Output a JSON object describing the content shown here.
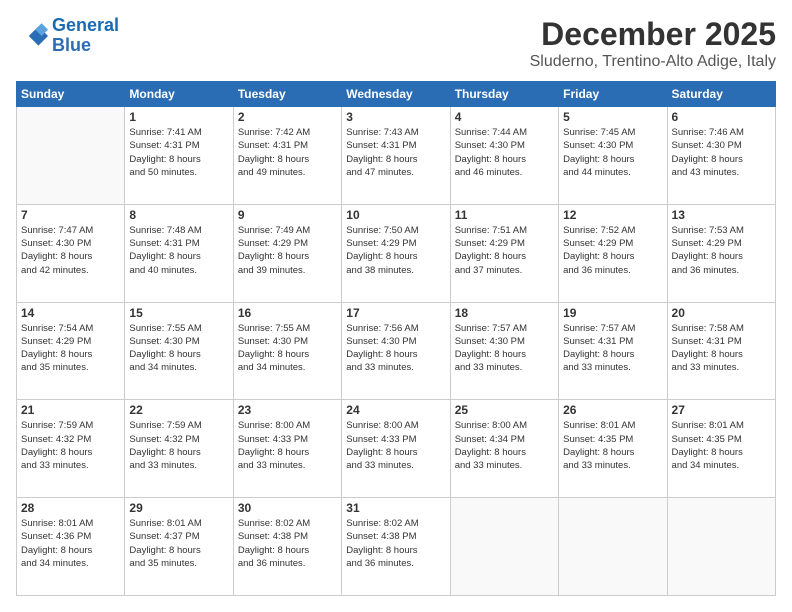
{
  "logo": {
    "line1": "General",
    "line2": "Blue"
  },
  "title": "December 2025",
  "subtitle": "Sluderno, Trentino-Alto Adige, Italy",
  "days_of_week": [
    "Sunday",
    "Monday",
    "Tuesday",
    "Wednesday",
    "Thursday",
    "Friday",
    "Saturday"
  ],
  "weeks": [
    [
      {
        "day": "",
        "info": ""
      },
      {
        "day": "1",
        "info": "Sunrise: 7:41 AM\nSunset: 4:31 PM\nDaylight: 8 hours\nand 50 minutes."
      },
      {
        "day": "2",
        "info": "Sunrise: 7:42 AM\nSunset: 4:31 PM\nDaylight: 8 hours\nand 49 minutes."
      },
      {
        "day": "3",
        "info": "Sunrise: 7:43 AM\nSunset: 4:31 PM\nDaylight: 8 hours\nand 47 minutes."
      },
      {
        "day": "4",
        "info": "Sunrise: 7:44 AM\nSunset: 4:30 PM\nDaylight: 8 hours\nand 46 minutes."
      },
      {
        "day": "5",
        "info": "Sunrise: 7:45 AM\nSunset: 4:30 PM\nDaylight: 8 hours\nand 44 minutes."
      },
      {
        "day": "6",
        "info": "Sunrise: 7:46 AM\nSunset: 4:30 PM\nDaylight: 8 hours\nand 43 minutes."
      }
    ],
    [
      {
        "day": "7",
        "info": "Sunrise: 7:47 AM\nSunset: 4:30 PM\nDaylight: 8 hours\nand 42 minutes."
      },
      {
        "day": "8",
        "info": "Sunrise: 7:48 AM\nSunset: 4:31 PM\nDaylight: 8 hours\nand 40 minutes."
      },
      {
        "day": "9",
        "info": "Sunrise: 7:49 AM\nSunset: 4:29 PM\nDaylight: 8 hours\nand 39 minutes."
      },
      {
        "day": "10",
        "info": "Sunrise: 7:50 AM\nSunset: 4:29 PM\nDaylight: 8 hours\nand 38 minutes."
      },
      {
        "day": "11",
        "info": "Sunrise: 7:51 AM\nSunset: 4:29 PM\nDaylight: 8 hours\nand 37 minutes."
      },
      {
        "day": "12",
        "info": "Sunrise: 7:52 AM\nSunset: 4:29 PM\nDaylight: 8 hours\nand 36 minutes."
      },
      {
        "day": "13",
        "info": "Sunrise: 7:53 AM\nSunset: 4:29 PM\nDaylight: 8 hours\nand 36 minutes."
      }
    ],
    [
      {
        "day": "14",
        "info": "Sunrise: 7:54 AM\nSunset: 4:29 PM\nDaylight: 8 hours\nand 35 minutes."
      },
      {
        "day": "15",
        "info": "Sunrise: 7:55 AM\nSunset: 4:30 PM\nDaylight: 8 hours\nand 34 minutes."
      },
      {
        "day": "16",
        "info": "Sunrise: 7:55 AM\nSunset: 4:30 PM\nDaylight: 8 hours\nand 34 minutes."
      },
      {
        "day": "17",
        "info": "Sunrise: 7:56 AM\nSunset: 4:30 PM\nDaylight: 8 hours\nand 33 minutes."
      },
      {
        "day": "18",
        "info": "Sunrise: 7:57 AM\nSunset: 4:30 PM\nDaylight: 8 hours\nand 33 minutes."
      },
      {
        "day": "19",
        "info": "Sunrise: 7:57 AM\nSunset: 4:31 PM\nDaylight: 8 hours\nand 33 minutes."
      },
      {
        "day": "20",
        "info": "Sunrise: 7:58 AM\nSunset: 4:31 PM\nDaylight: 8 hours\nand 33 minutes."
      }
    ],
    [
      {
        "day": "21",
        "info": "Sunrise: 7:59 AM\nSunset: 4:32 PM\nDaylight: 8 hours\nand 33 minutes."
      },
      {
        "day": "22",
        "info": "Sunrise: 7:59 AM\nSunset: 4:32 PM\nDaylight: 8 hours\nand 33 minutes."
      },
      {
        "day": "23",
        "info": "Sunrise: 8:00 AM\nSunset: 4:33 PM\nDaylight: 8 hours\nand 33 minutes."
      },
      {
        "day": "24",
        "info": "Sunrise: 8:00 AM\nSunset: 4:33 PM\nDaylight: 8 hours\nand 33 minutes."
      },
      {
        "day": "25",
        "info": "Sunrise: 8:00 AM\nSunset: 4:34 PM\nDaylight: 8 hours\nand 33 minutes."
      },
      {
        "day": "26",
        "info": "Sunrise: 8:01 AM\nSunset: 4:35 PM\nDaylight: 8 hours\nand 33 minutes."
      },
      {
        "day": "27",
        "info": "Sunrise: 8:01 AM\nSunset: 4:35 PM\nDaylight: 8 hours\nand 34 minutes."
      }
    ],
    [
      {
        "day": "28",
        "info": "Sunrise: 8:01 AM\nSunset: 4:36 PM\nDaylight: 8 hours\nand 34 minutes."
      },
      {
        "day": "29",
        "info": "Sunrise: 8:01 AM\nSunset: 4:37 PM\nDaylight: 8 hours\nand 35 minutes."
      },
      {
        "day": "30",
        "info": "Sunrise: 8:02 AM\nSunset: 4:38 PM\nDaylight: 8 hours\nand 36 minutes."
      },
      {
        "day": "31",
        "info": "Sunrise: 8:02 AM\nSunset: 4:38 PM\nDaylight: 8 hours\nand 36 minutes."
      },
      {
        "day": "",
        "info": ""
      },
      {
        "day": "",
        "info": ""
      },
      {
        "day": "",
        "info": ""
      }
    ]
  ]
}
